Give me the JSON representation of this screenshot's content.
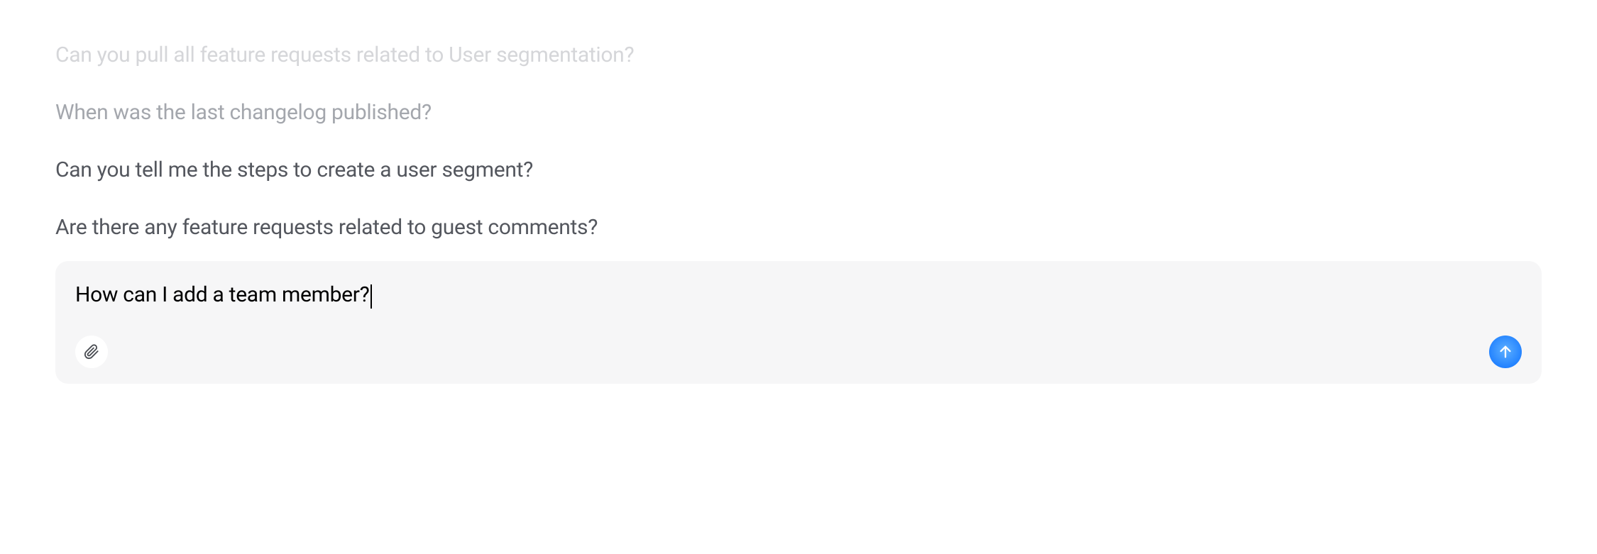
{
  "suggestions": [
    {
      "text": "Can you pull all feature requests related to User segmentation?",
      "fade": "fade-1"
    },
    {
      "text": "When was the last changelog published?",
      "fade": "fade-2"
    },
    {
      "text": "Can you tell me the steps to create a user segment?",
      "fade": "fade-3"
    },
    {
      "text": "Are there any feature requests related to guest comments?",
      "fade": "fade-4"
    }
  ],
  "input": {
    "value": "How can I add a team member?"
  }
}
